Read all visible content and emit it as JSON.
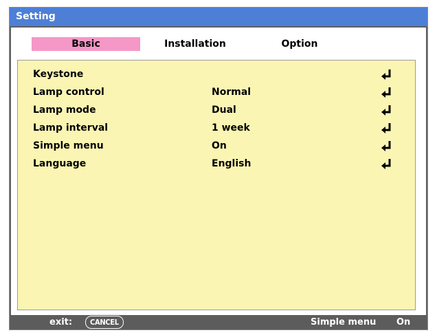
{
  "window": {
    "title": "Setting"
  },
  "tabs": [
    {
      "label": "Basic",
      "active": true
    },
    {
      "label": "Installation",
      "active": false
    },
    {
      "label": "Option",
      "active": false
    }
  ],
  "menu": {
    "items": [
      {
        "label": "Keystone",
        "value": "",
        "icon": "enter-return-icon"
      },
      {
        "label": "Lamp control",
        "value": "Normal",
        "icon": "enter-return-icon"
      },
      {
        "label": "Lamp mode",
        "value": "Dual",
        "icon": "enter-return-icon"
      },
      {
        "label": "Lamp interval",
        "value": "1 week",
        "icon": "enter-return-icon"
      },
      {
        "label": "Simple menu",
        "value": "On",
        "icon": "enter-return-icon"
      },
      {
        "label": "Language",
        "value": "English",
        "icon": "enter-return-icon"
      }
    ]
  },
  "footer": {
    "exit_label": "exit:",
    "cancel_key": "CANCEL",
    "status_label": "Simple menu",
    "status_value": "On"
  },
  "colors": {
    "titlebar": "#4d7fd6",
    "active_tab": "#f597c7",
    "panel": "#fbf5b3",
    "footer": "#5c5c5c"
  }
}
